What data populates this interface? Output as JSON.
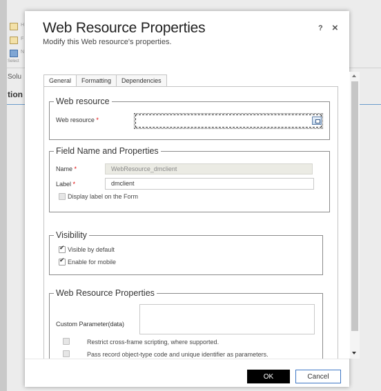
{
  "background": {
    "ribbon_items": [
      {
        "label": "H",
        "style": "normal"
      },
      {
        "label": "F",
        "style": "normal"
      },
      {
        "label": "N",
        "style": "blue"
      }
    ],
    "select_text": "Select",
    "solu_text": "Solu",
    "tion_text": "tion"
  },
  "dialog": {
    "title": "Web Resource Properties",
    "subtitle": "Modify this Web resource's properties.",
    "help_label": "?",
    "close_label": "×"
  },
  "tabs": [
    {
      "label": "General",
      "active": true
    },
    {
      "label": "Formatting",
      "active": false
    },
    {
      "label": "Dependencies",
      "active": false
    }
  ],
  "web_resource_section": {
    "legend": "Web resource",
    "field_label": "Web resource",
    "required_marker": "*",
    "value": ""
  },
  "field_name_section": {
    "legend": "Field Name and Properties",
    "name_label": "Name",
    "name_value": "WebResource_dmclient",
    "label_label": "Label",
    "label_value": "dmclient",
    "required_marker": "*",
    "display_label_text": "Display label on the Form",
    "display_label_checked": false
  },
  "visibility_section": {
    "legend": "Visibility",
    "visible_default_text": "Visible by default",
    "visible_default_checked": true,
    "enable_mobile_text": "Enable for mobile",
    "enable_mobile_checked": true
  },
  "properties_section": {
    "legend": "Web Resource Properties",
    "custom_param_label": "Custom Parameter(data)",
    "custom_param_value": "",
    "restrict_text": "Restrict cross-frame scripting, where supported.",
    "restrict_checked": false,
    "pass_record_text": "Pass record object-type code and unique identifier as parameters.",
    "pass_record_checked": false
  },
  "footer": {
    "ok_label": "OK",
    "cancel_label": "Cancel"
  },
  "colors": {
    "primary_button": "#000000",
    "cancel_border": "#3a75c4",
    "required": "#e00000",
    "accent_line": "#6b9ccb"
  },
  "icons": [
    "lookup-icon",
    "help-icon",
    "close-icon",
    "scroll-up-icon",
    "scroll-down-icon",
    "checkbox-icon"
  ]
}
